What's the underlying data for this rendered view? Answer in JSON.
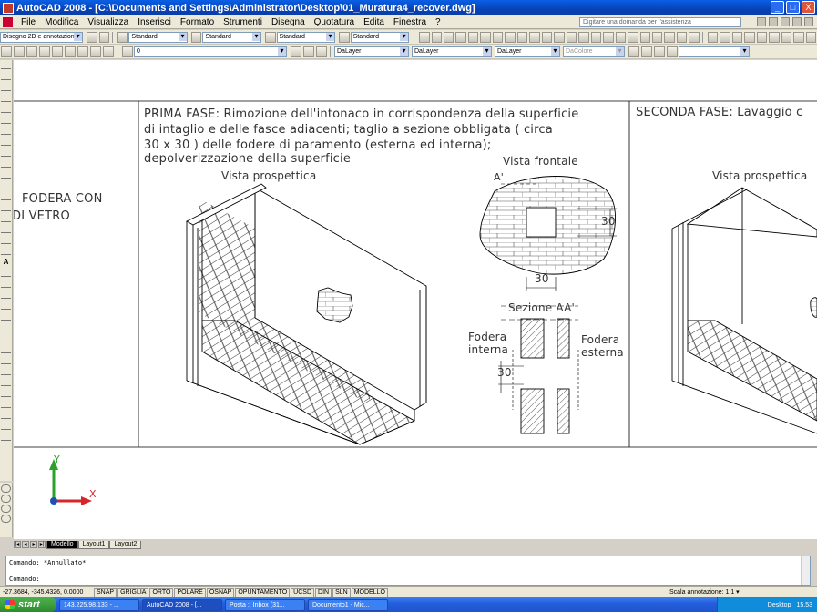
{
  "window": {
    "title": "AutoCAD 2008 - [C:\\Documents and Settings\\Administrator\\Desktop\\01_Muratura4_recover.dwg]",
    "buttons": [
      "_",
      "□",
      "X"
    ]
  },
  "menu": {
    "items": [
      "File",
      "Modifica",
      "Visualizza",
      "Inserisci",
      "Formato",
      "Strumenti",
      "Disegna",
      "Quotatura",
      "Edita",
      "Finestra",
      "?"
    ],
    "help_placeholder": "Digitare una domanda per l'assistenza"
  },
  "toolbar1": {
    "workspace": "Disegno 2D e annotazione",
    "text_style": "Standard",
    "dim_style": "Standard",
    "table_style": "Standard",
    "mleader_style": "Standard"
  },
  "toolbar2": {
    "layer": "0",
    "color": "DaLayer",
    "linetype": "DaLayer",
    "lineweight": "DaLayer",
    "plotstyle": "DaColore"
  },
  "drawing": {
    "left_text_1": "FODERA CON",
    "left_text_2": "DI VETRO",
    "phase1_lines": [
      "PRIMA FASE: Rimozione dell'intonaco in corrispondenza della superficie",
      "di intaglio e delle fasce adiacenti; taglio a sezione obbligata ( circa",
      "30 x 30 ) delle fodere di paramento (esterna ed interna);",
      "depolverizzazione della superficie"
    ],
    "phase2_line": "SECONDA FASE: Lavaggio c",
    "view_persp_1": "Vista prospettica",
    "view_persp_2": "Vista prospettica",
    "view_front": "Vista frontale",
    "section_label": "Sezione AA'",
    "marker_a": "A'",
    "dim_30_right": "30",
    "dim_30_bottom": "30",
    "dim_30_section": "30",
    "fodera_interna_1": "Fodera",
    "fodera_interna_2": "interna",
    "fodera_esterna_1": "Fodera",
    "fodera_esterna_2": "esterna",
    "ucs_x": "X",
    "ucs_y": "Y"
  },
  "tabs": [
    "Modello",
    "Layout1",
    "Layout2"
  ],
  "command": {
    "line1": "Comando: *Annullato*",
    "line2": "Comando:"
  },
  "status": {
    "coords": "-27.3684, -345.4326, 0.0000",
    "buttons": [
      "SNAP",
      "GRIGLIA",
      "ORTO",
      "POLARE",
      "OSNAP",
      "OPUNTAMENTO",
      "UCSD",
      "DIN",
      "SLN",
      "MODELLO"
    ],
    "scale": "Scala annotazione:  1:1 ▾"
  },
  "taskbar": {
    "start": "start",
    "tasks": [
      "143.225.98.133 - ...",
      "AutoCAD 2008 - [...",
      "Posta :: Inbox (31...",
      "Documento1 - Mic..."
    ],
    "desktop": "Desktop",
    "time": "15.53"
  }
}
